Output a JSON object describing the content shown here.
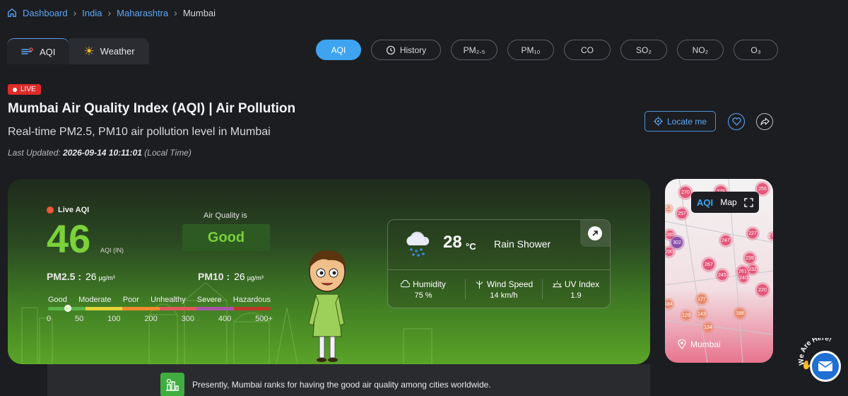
{
  "breadcrumb": {
    "items": [
      "Dashboard",
      "India",
      "Maharashtra"
    ],
    "current": "Mumbai"
  },
  "main_tabs": [
    {
      "label": "AQI"
    },
    {
      "label": "Weather"
    }
  ],
  "pills": [
    {
      "label": "AQI",
      "active": true
    },
    {
      "label": "History"
    },
    {
      "label": "PM₂.₅"
    },
    {
      "label": "PM₁₀"
    },
    {
      "label": "CO"
    },
    {
      "label": "SO₂"
    },
    {
      "label": "NO₂"
    },
    {
      "label": "O₃"
    }
  ],
  "live_badge": "LIVE",
  "title": "Mumbai Air Quality Index (AQI) | Air Pollution",
  "subtitle": "Real-time PM2.5, PM10 air pollution level in Mumbai",
  "updated": {
    "prefix": "Last Updated:",
    "timestamp": "2026-09-14 10:11:01",
    "suffix": "(Local Time)"
  },
  "actions": {
    "locate": "Locate me"
  },
  "aqi": {
    "live_label": "Live AQI",
    "value": "46",
    "unit": "AQI (IN)",
    "aq_is_label": "Air Quality is",
    "status": "Good",
    "pm25_label": "PM2.5 :",
    "pm25_value": "26",
    "pm10_label": "PM10 :",
    "pm10_value": "26",
    "pm_unit": "µg/m³",
    "level_fraction": 0.09,
    "scale_labels": [
      "Good",
      "Moderate",
      "Poor",
      "Unhealthy",
      "Severe",
      "Hazardous"
    ],
    "scale_colors": [
      "#59b44a",
      "#e6d23a",
      "#ef8c2b",
      "#e05a5a",
      "#a855a8",
      "#c0392b"
    ],
    "scale_numbers": [
      "0",
      "50",
      "100",
      "200",
      "300",
      "400",
      "500+"
    ]
  },
  "weather": {
    "temp": "28",
    "temp_unit": "°C",
    "condition": "Rain Shower",
    "humidity_label": "Humidity",
    "humidity_value": "75 %",
    "wind_label": "Wind Speed",
    "wind_value": "14 km/h",
    "uv_label": "UV Index",
    "uv_value": "1.9"
  },
  "map": {
    "logo": "AQI",
    "label": "Map",
    "city": "Mumbai",
    "bubbles": [
      "270",
      "279",
      "256",
      "257",
      "285",
      "302",
      "290",
      "247",
      "227",
      "239",
      "267",
      "245",
      "261",
      "232",
      "240",
      "220",
      "177",
      "184",
      "188",
      "129",
      "143",
      "134",
      "53",
      "273"
    ]
  },
  "floating": {
    "we_are_here": "We Are Here!"
  },
  "rank": {
    "text": "Presently, Mumbai ranks for having the good air quality among cities worldwide."
  }
}
